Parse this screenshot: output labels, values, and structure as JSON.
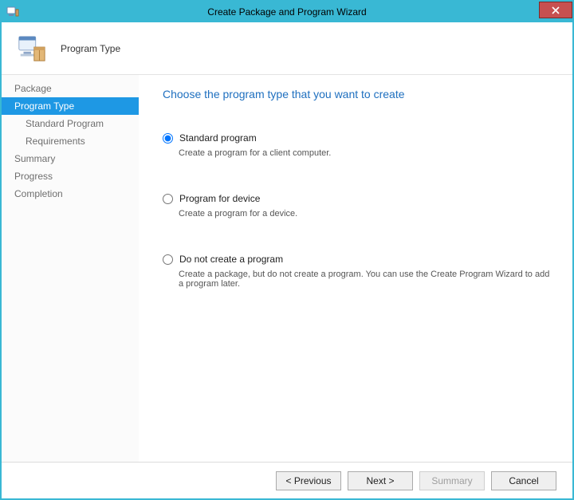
{
  "title": "Create Package and Program Wizard",
  "header": {
    "title": "Program Type"
  },
  "sidebar": {
    "items": [
      {
        "label": "Package"
      },
      {
        "label": "Program Type"
      },
      {
        "label": "Standard Program"
      },
      {
        "label": "Requirements"
      },
      {
        "label": "Summary"
      },
      {
        "label": "Progress"
      },
      {
        "label": "Completion"
      }
    ]
  },
  "content": {
    "heading": "Choose the program type that you want to create",
    "options": [
      {
        "label": "Standard program",
        "desc": "Create a program for a client computer.",
        "selected": true
      },
      {
        "label": "Program for device",
        "desc": "Create a program for a device.",
        "selected": false
      },
      {
        "label": "Do not create a program",
        "desc": "Create a package, but do not create a program. You can use the Create Program Wizard to add a program later.",
        "selected": false
      }
    ]
  },
  "footer": {
    "previous": "< Previous",
    "next": "Next >",
    "summary": "Summary",
    "cancel": "Cancel"
  }
}
